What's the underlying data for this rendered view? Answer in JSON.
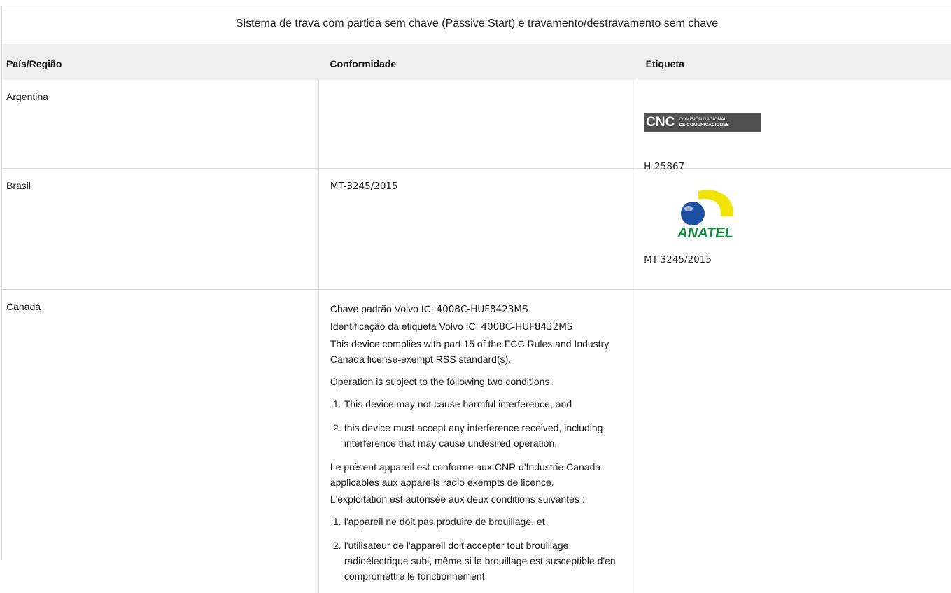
{
  "caption": "Sistema de trava com partida sem chave (Passive Start) e travamento/destravamento sem chave",
  "columns": {
    "country": "País/Região",
    "compliance": "Conformidade",
    "label": "Etiqueta"
  },
  "rows": {
    "argentina": {
      "country": "Argentina",
      "logo": {
        "big": "CNC",
        "small_line1": "COMISIÓN NACIONAL",
        "small_line2": "DE COMUNICACIONES"
      },
      "label_code": "H-25867"
    },
    "brasil": {
      "country": "Brasil",
      "compliance": "MT-3245/2015",
      "logo_text": "ANATEL",
      "label_code": "MT-3245/2015"
    },
    "canada": {
      "country": "Canadá",
      "line1_prefix": "Chave padrão Volvo IC: ",
      "line1_code": "4008C-HUF8423MS",
      "line2_prefix": "Identificação da etiqueta Volvo IC: ",
      "line2_code": "4008C-HUF8432MS",
      "line3": "This device complies with part 15 of the FCC Rules and Industry Canada license-exempt RSS standard(s).",
      "line4": "Operation is subject to the following two conditions:",
      "en_list": [
        {
          "num": "1.",
          "text": "This device may not cause harmful interference, and"
        },
        {
          "num": "2.",
          "text": "this device must accept any interference received, including interference that may cause undesired operation."
        }
      ],
      "fr_line1": "Le présent appareil est conforme aux CNR d'Industrie Canada applicables aux appareils radio exempts de licence.",
      "fr_line2": "L'exploitation est autorisée aux deux conditions suivantes :",
      "fr_list": [
        {
          "num": "1.",
          "text": "l'appareil ne doit pas produire de brouillage, et"
        },
        {
          "num": "2.",
          "text": "l'utilisateur de l'appareil doit accepter tout brouillage radioélectrique subi, même si le brouillage est susceptible d'en compromettre le fonctionnement."
        }
      ]
    }
  },
  "colors": {
    "header_bg": "#efefef",
    "border": "#d8d8d8",
    "anatel_yellow": "#f2e400",
    "anatel_blue": "#1d4fa3",
    "anatel_green": "#0a8a3a",
    "cnc_bg": "#505050"
  }
}
